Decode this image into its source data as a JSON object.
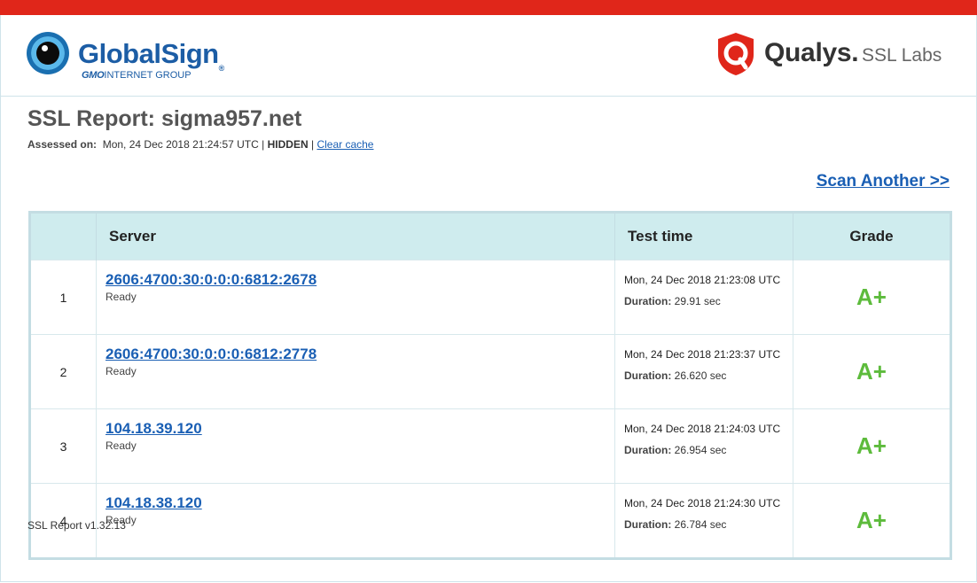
{
  "colors": {
    "top_bar": "#e0261a",
    "link": "#1a5fb4",
    "grade_green": "#5dbb3c",
    "table_header_bg": "#cfecee"
  },
  "header": {
    "globalsign": {
      "name": "GlobalSign",
      "registered": "®",
      "gmo": "GMO",
      "group": "INTERNET GROUP",
      "icon": "eye-logo-icon"
    },
    "qualys": {
      "name": "Qualys.",
      "product": "SSL Labs",
      "icon": "qualys-shield-icon"
    }
  },
  "report": {
    "title": "SSL Report: sigma957.net",
    "assessed_label": "Assessed on:",
    "assessed_value": "Mon, 24 Dec 2018 21:24:57 UTC",
    "separator": "|",
    "hidden_label": "HIDDEN",
    "clear_cache": "Clear cache",
    "scan_another": "Scan Another >>"
  },
  "table": {
    "headers": {
      "num": "",
      "server": "Server",
      "time": "Test time",
      "grade": "Grade"
    },
    "duration_label": "Duration:",
    "rows": [
      {
        "num": "1",
        "server": "2606:4700:30:0:0:0:6812:2678",
        "status": "Ready",
        "time": "Mon, 24 Dec 2018 21:23:08 UTC",
        "duration": "29.91 sec",
        "grade": "A+"
      },
      {
        "num": "2",
        "server": "2606:4700:30:0:0:0:6812:2778",
        "status": "Ready",
        "time": "Mon, 24 Dec 2018 21:23:37 UTC",
        "duration": "26.620 sec",
        "grade": "A+"
      },
      {
        "num": "3",
        "server": "104.18.39.120",
        "status": "Ready",
        "time": "Mon, 24 Dec 2018 21:24:03 UTC",
        "duration": "26.954 sec",
        "grade": "A+"
      },
      {
        "num": "4",
        "server": "104.18.38.120",
        "status": "Ready",
        "time": "Mon, 24 Dec 2018 21:24:30 UTC",
        "duration": "26.784 sec",
        "grade": "A+"
      }
    ]
  },
  "footer": {
    "version": "SSL Report v1.32.13"
  }
}
